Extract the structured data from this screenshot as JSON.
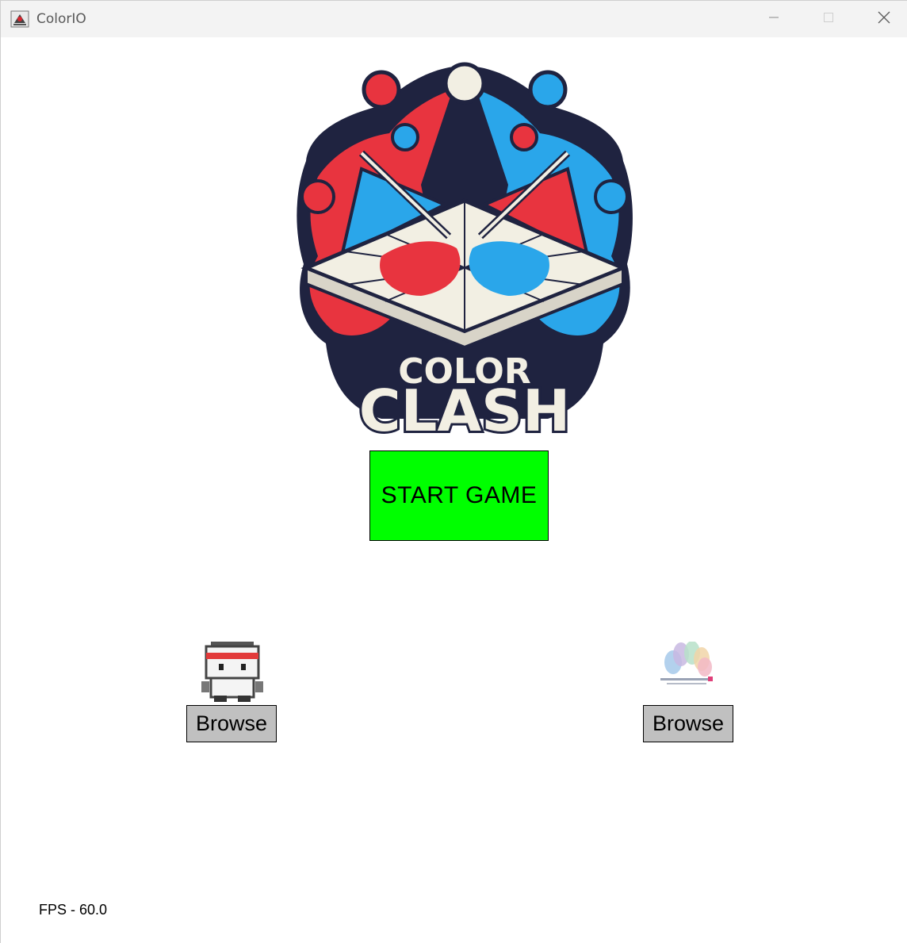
{
  "window": {
    "title": "ColorIO",
    "icons": {
      "app": "java-cup-icon",
      "minimize": "minimize-icon",
      "maximize": "maximize-icon",
      "close": "close-icon"
    }
  },
  "logo": {
    "line1": "COLOR",
    "line2": "CLASH",
    "colors": {
      "red": "#e8343f",
      "blue": "#2aa6ea",
      "navy": "#1f2340",
      "cream": "#f2efe3"
    }
  },
  "start_button": {
    "label": "START GAME",
    "color": "#00ff00"
  },
  "players": [
    {
      "avatar": "pixel-character-headband-icon",
      "browse_label": "Browse"
    },
    {
      "avatar": "rainbow-peacock-logo-icon",
      "browse_label": "Browse"
    }
  ],
  "status": {
    "fps_text": "FPS - 60.0"
  }
}
